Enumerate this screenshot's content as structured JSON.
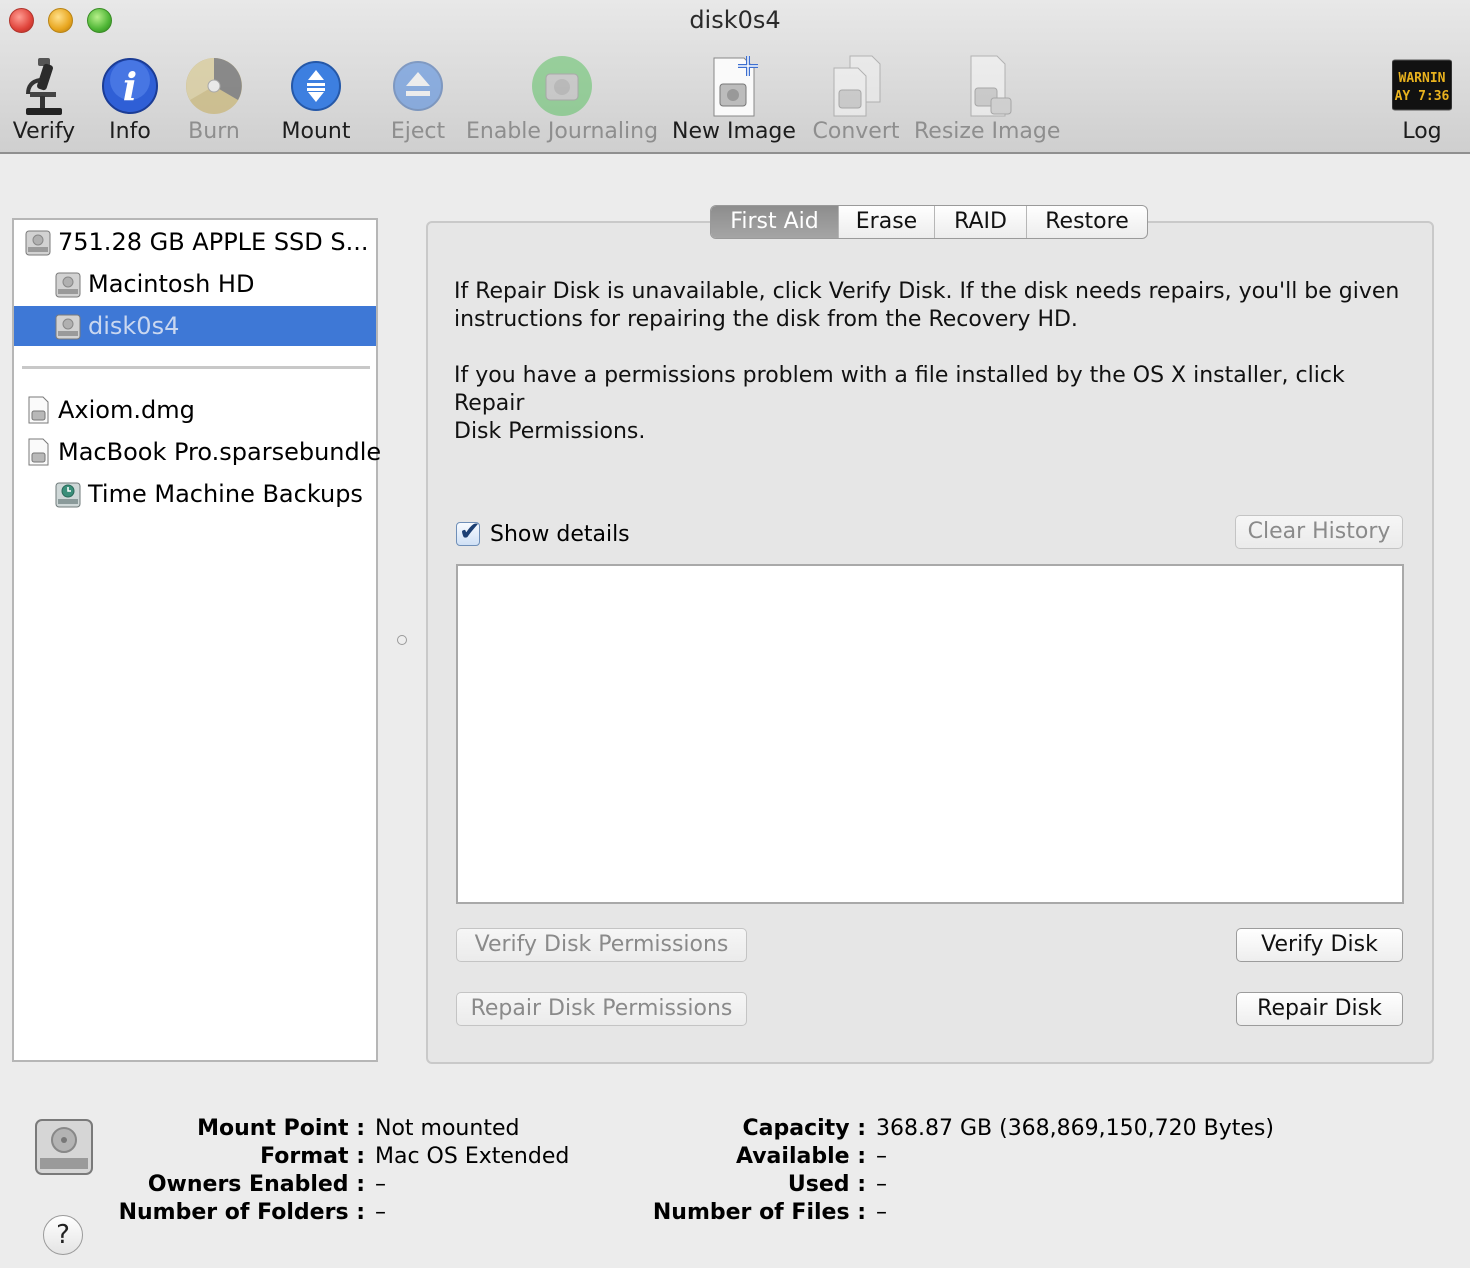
{
  "window": {
    "title": "disk0s4"
  },
  "toolbar": {
    "verify": "Verify",
    "info": "Info",
    "burn": "Burn",
    "mount": "Mount",
    "eject": "Eject",
    "enable_journaling": "Enable Journaling",
    "new_image": "New Image",
    "convert": "Convert",
    "resize_image": "Resize Image",
    "log": "Log",
    "log_icon_line1": "WARNIN",
    "log_icon_line2": "AY 7:36"
  },
  "sidebar": {
    "items": [
      {
        "label": "751.28 GB APPLE SSD S..."
      },
      {
        "label": "Macintosh HD"
      },
      {
        "label": "disk0s4"
      },
      {
        "label": "Axiom.dmg"
      },
      {
        "label": "MacBook Pro.sparsebundle"
      },
      {
        "label": "Time Machine Backups"
      }
    ]
  },
  "tabs": {
    "first_aid": "First Aid",
    "erase": "Erase",
    "raid": "RAID",
    "restore": "Restore"
  },
  "first_aid": {
    "para1_line1": "If Repair Disk is unavailable, click Verify Disk. If the disk needs repairs, you'll be given",
    "para1_line2": "instructions for repairing the disk from the Recovery HD.",
    "para2_line1": "If you have a permissions problem with a file installed by the OS X installer, click Repair",
    "para2_line2": "Disk Permissions.",
    "show_details": "Show details",
    "clear_history": "Clear History",
    "verify_permissions": "Verify Disk Permissions",
    "repair_permissions": "Repair Disk Permissions",
    "verify_disk": "Verify Disk",
    "repair_disk": "Repair Disk"
  },
  "info": {
    "mount_point_label": "Mount Point :",
    "mount_point": "Not mounted",
    "format_label": "Format :",
    "format": "Mac OS Extended",
    "owners_label": "Owners Enabled :",
    "owners": "–",
    "folders_label": "Number of Folders :",
    "folders": "–",
    "capacity_label": "Capacity :",
    "capacity": "368.87 GB (368,869,150,720 Bytes)",
    "available_label": "Available :",
    "available": "–",
    "used_label": "Used :",
    "used": "–",
    "files_label": "Number of Files :",
    "files": "–",
    "help": "?"
  }
}
